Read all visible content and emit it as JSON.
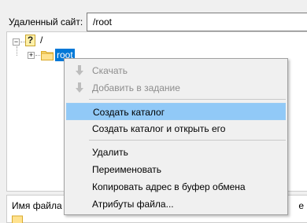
{
  "site": {
    "label": "Удаленный сайт:",
    "path": "/root"
  },
  "tree": {
    "root_label": "/",
    "child_label": "root",
    "expand_glyph": "+",
    "collapse_glyph": "−",
    "root_icon": "question-mark-icon",
    "child_icon": "folder-icon"
  },
  "list": {
    "column_name": "Имя файла",
    "column_tail": "е"
  },
  "context_menu": {
    "items": [
      {
        "label": "Скачать",
        "enabled": false,
        "icon": "download-arrow-icon"
      },
      {
        "label": "Добавить в задание",
        "enabled": false,
        "icon": "add-to-queue-icon"
      },
      {
        "label": "Создать каталог",
        "enabled": true,
        "highlighted": true
      },
      {
        "label": "Создать каталог и открыть его",
        "enabled": true
      },
      {
        "label": "Удалить",
        "enabled": true
      },
      {
        "label": "Переименовать",
        "enabled": true
      },
      {
        "label": "Копировать адрес в буфер обмена",
        "enabled": true
      },
      {
        "label": "Атрибуты файла...",
        "enabled": true
      }
    ]
  },
  "colors": {
    "selection": "#0078d7",
    "menu_highlight": "#91c9f7",
    "disabled_text": "#8d8d8d"
  }
}
